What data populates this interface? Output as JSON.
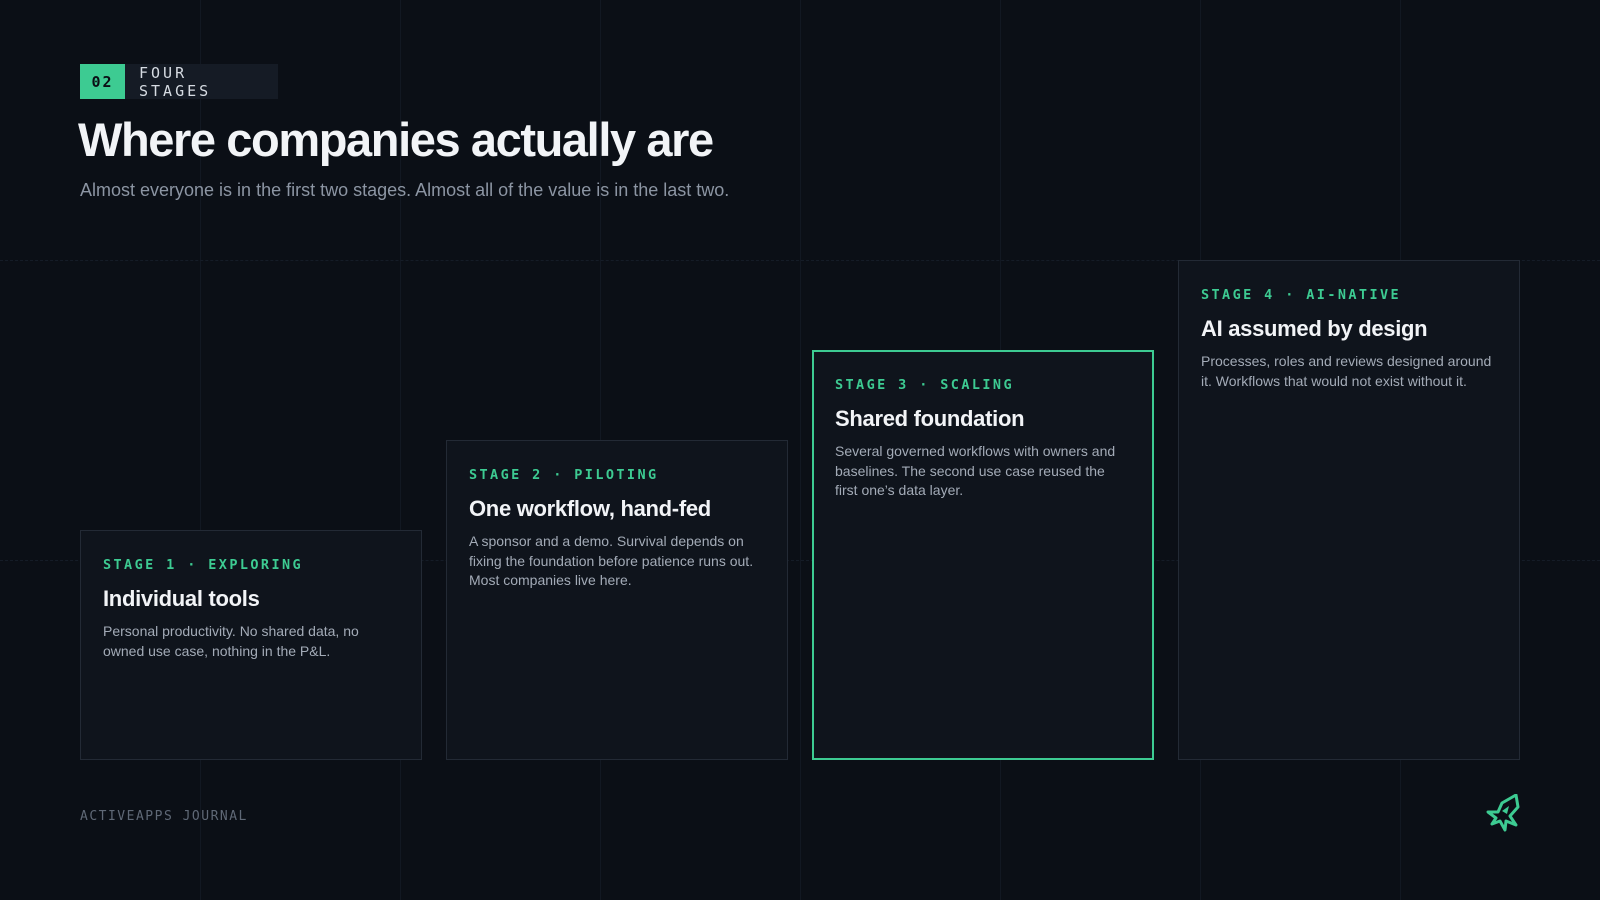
{
  "section": {
    "number": "02",
    "label": "FOUR STAGES"
  },
  "title": "Where companies actually are",
  "subtitle": "Almost everyone is in the first two stages. Almost all of the value is in the last two.",
  "stages": [
    {
      "tag": "STAGE 1 · EXPLORING",
      "heading": "Individual tools",
      "description": "Personal productivity. No shared data, no owned use case, nothing in the P&L.",
      "highlighted": false
    },
    {
      "tag": "STAGE 2 · PILOTING",
      "heading": "One workflow, hand-fed",
      "description": "A sponsor and a demo. Survival depends on fixing the foundation before patience runs out. Most companies live here.",
      "highlighted": false
    },
    {
      "tag": "STAGE 3 · SCALING",
      "heading": "Shared foundation",
      "description": "Several governed workflows with owners and baselines. The second use case reused the first one’s data layer.",
      "highlighted": true
    },
    {
      "tag": "STAGE 4 · AI-NATIVE",
      "heading": "AI assumed by design",
      "description": "Processes, roles and reviews designed around it. Workflows that would not exist without it.",
      "highlighted": false
    }
  ],
  "footer": "ACTIVEAPPS JOURNAL",
  "logo_icon": "activeapps-logo-icon",
  "colors": {
    "background": "#0b0f16",
    "accent": "#3dcb92",
    "card": "#0f141c",
    "card_border": "#232a35",
    "text_muted": "#8c95a3"
  }
}
